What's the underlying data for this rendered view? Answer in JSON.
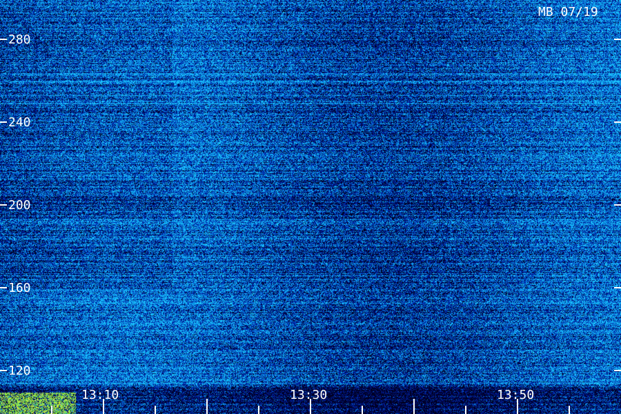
{
  "chart_data": {
    "type": "heatmap",
    "title": "MB 07/19",
    "y_ticks": [
      280,
      240,
      200,
      160,
      120
    ],
    "x_tick_labels": [
      "13:10",
      "13:30",
      "13:50"
    ],
    "y_range": [
      105,
      297
    ],
    "colors": {
      "background": "#0b1a8f",
      "low": "#000018",
      "mid": "#1a3cff",
      "high": "#00e5ff",
      "hot": "#ffff66",
      "labels": "#ffffff"
    }
  }
}
